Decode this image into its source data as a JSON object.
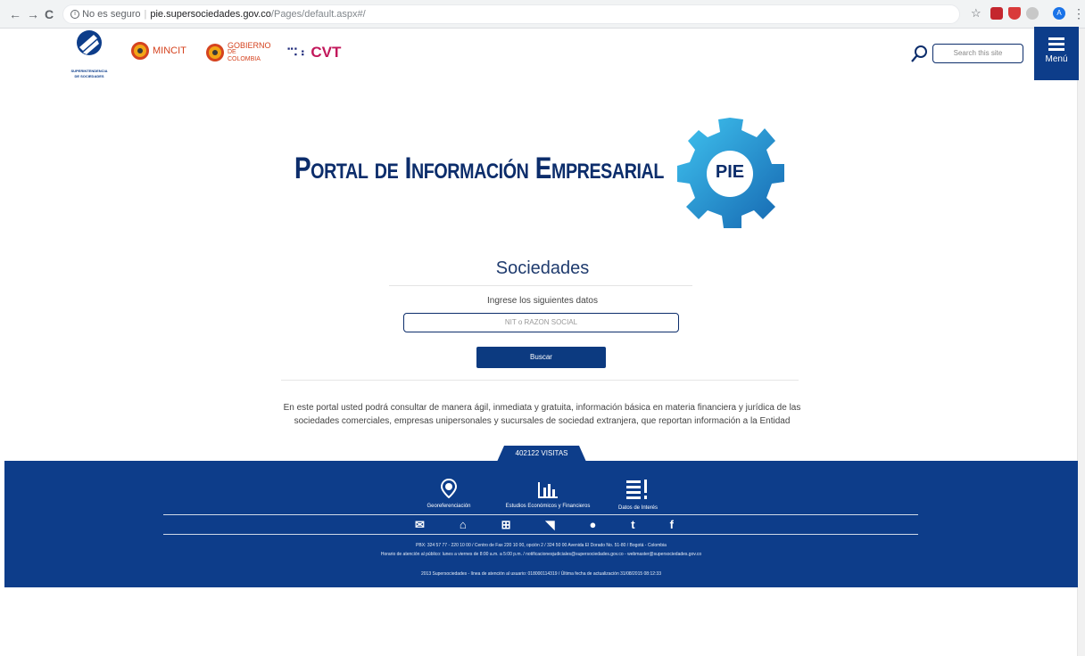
{
  "browser": {
    "back": "←",
    "forward": "→",
    "reload": "C",
    "security_label": "No es seguro",
    "url_host": "pie.supersociedades.gov.co",
    "url_path": "/Pages/default.aspx#/",
    "bookmark_icon": "star-icon",
    "profile_initial": "A",
    "menu_glyph": "⋮"
  },
  "header": {
    "logo_org_line1": "SUPERINTENDENCIA",
    "logo_org_line2": "DE SOCIEDADES",
    "mincit": "MINCIT",
    "gobierno_line1": "GOBIERNO",
    "gobierno_line2": "DE COLOMBIA",
    "cvt": "CVT",
    "search_placeholder": "Search this site",
    "menu_label": "Menú"
  },
  "hero": {
    "title": "Portal de Información Empresarial",
    "logo_text": "PIE"
  },
  "search_panel": {
    "title": "Sociedades",
    "hint": "Ingrese los siguientes datos",
    "input_placeholder": "NIT o RAZON SOCIAL",
    "button": "Buscar",
    "description": "En este portal usted podrá consultar de manera ágil, inmediata y gratuita, información básica en materia financiera y jurídica de las sociedades comerciales, empresas unipersonales y sucursales de sociedad extranjera, que reportan información a la Entidad"
  },
  "footer": {
    "visits": "402122 VISITAS",
    "links": [
      {
        "label": "Georeferenciación",
        "icon": "map-pin-icon"
      },
      {
        "label": "Estudios Económicos y Financieros",
        "icon": "bar-chart-icon"
      },
      {
        "label": "Datos de Interés",
        "icon": "list-alert-icon"
      }
    ],
    "social_icons": [
      "mail-icon",
      "home-icon",
      "sitemap-icon",
      "rss-icon",
      "blogger-icon",
      "twitter-icon",
      "facebook-icon"
    ],
    "contact_line1": "PBX: 324 57 77 - 220 10 00 / Centro de Fax 220 10 00, opción 2 / 324 50 00 Avenida El Dorado No. 51-80 / Bogotá - Colombia",
    "contact_line2": "Horario de atención al público: lunes a viernes de 8:00 a.m. a 5:00 p.m. / notificacionesjudiciales@supersociedades.gov.co - webmaster@supersociedades.gov.co",
    "copyright": "2013 Supersociedades - línea de atención al usuario: 018000114319 / Última fecha de actualización 31/08/2015 08:12:33"
  },
  "colors": {
    "brand_blue": "#0d3d8a",
    "title_blue": "#0c2d6b",
    "pie_cyan": "#29a8e0"
  }
}
